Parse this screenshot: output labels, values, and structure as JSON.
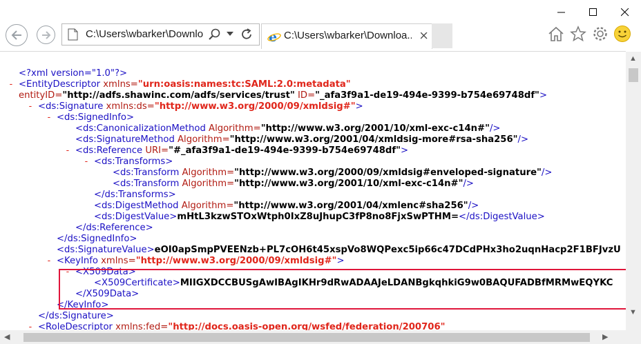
{
  "browser": {
    "address": "C:\\Users\\wbarker\\Downlo",
    "tab_title": "C:\\Users\\wbarker\\Downloa...",
    "accent": "#1e78d6"
  },
  "xml": {
    "l0": "<?xml version=\"1.0\"?>",
    "l1_tag": "<EntityDescriptor",
    "l1_attr": " xmlns=",
    "l1_val": "\"urn:oasis:names:tc:SAML:2.0:metadata\"",
    "l1b_attr1": "entityID=",
    "l1b_val1": "\"http://adfs.shawinc.com/adfs/services/trust\"",
    "l1b_attr2": " ID=",
    "l1b_val2": "\"_afa3f9a1-de19-494e-9399-b754e69748df\"",
    "l1b_close": ">",
    "l2_tag": "<ds:Signature",
    "l2_attr": " xmlns:ds=",
    "l2_val": "\"http://www.w3.org/2000/09/xmldsig#\"",
    "l2_close": ">",
    "l3": "<ds:SignedInfo>",
    "l4_tag": "<ds:CanonicalizationMethod",
    "l4_attr": " Algorithm=",
    "l4_val": "\"http://www.w3.org/2001/10/xml-exc-c14n#\"",
    "l4_close": "/>",
    "l5_tag": "<ds:SignatureMethod",
    "l5_attr": " Algorithm=",
    "l5_val": "\"http://www.w3.org/2001/04/xmldsig-more#rsa-sha256\"",
    "l5_close": "/>",
    "l6_tag": "<ds:Reference",
    "l6_attr": " URI=",
    "l6_val": "\"#_afa3f9a1-de19-494e-9399-b754e69748df\"",
    "l6_close": ">",
    "l7": "<ds:Transforms>",
    "l8_tag": "<ds:Transform",
    "l8_attr": " Algorithm=",
    "l8_val": "\"http://www.w3.org/2000/09/xmldsig#enveloped-signature\"",
    "l8_close": "/>",
    "l9_tag": "<ds:Transform",
    "l9_attr": " Algorithm=",
    "l9_val": "\"http://www.w3.org/2001/10/xml-exc-c14n#\"",
    "l9_close": "/>",
    "l10": "</ds:Transforms>",
    "l11_tag": "<ds:DigestMethod",
    "l11_attr": " Algorithm=",
    "l11_val": "\"http://www.w3.org/2001/04/xmlenc#sha256\"",
    "l11_close": "/>",
    "l12_open": "<ds:DigestValue>",
    "l12_text": "mHtL3kzwSTOxWtph0IxZ8uJhupC3fP8no8FjxSwPTHM=",
    "l12_close": "</ds:DigestValue>",
    "l13": "</ds:Reference>",
    "l14": "</ds:SignedInfo>",
    "l15_open": "<ds:SignatureValue>",
    "l15_text": "eOI0apSmpPVEENzb+PL7cOH6t45xspVo8WQPexc5ip66c47DCdPHx3ho2uqnHacp2F1BFJvzU",
    "l16_tag": "<KeyInfo",
    "l16_attr": " xmlns=",
    "l16_val": "\"http://www.w3.org/2000/09/xmldsig#\"",
    "l16_close": ">",
    "l17": "<X509Data>",
    "l18_open": "<X509Certificate>",
    "l18_text": "MIIGXDCCBUSgAwIBAgIKHr9dRwADAAJeLDANBgkqhkiG9w0BAQUFADBfMRMwEQYKC",
    "l19": "</X509Data>",
    "l20": "</KeyInfo>",
    "l21": "</ds:Signature>",
    "l22_tag": "<RoleDescriptor",
    "l22_attr": " xmlns:fed=",
    "l22_val": "\"http://docs.oasis-open.org/wsfed/federation/200706\""
  }
}
